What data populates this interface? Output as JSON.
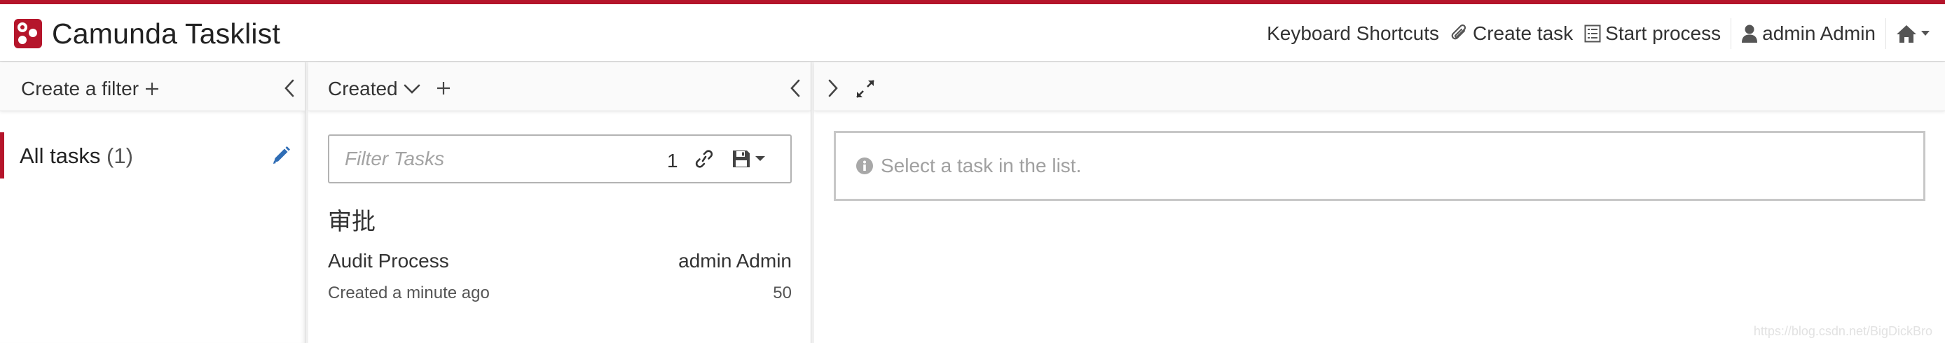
{
  "app": {
    "title": "Camunda Tasklist",
    "accent_color": "#b5152b"
  },
  "navbar": {
    "keyboard_shortcuts": "Keyboard Shortcuts",
    "create_task": {
      "label": "Create task",
      "icon": "paperclip-icon"
    },
    "start_process": {
      "label": "Start process",
      "icon": "list-alt-icon"
    },
    "user": {
      "label": "admin Admin",
      "icon": "user-icon"
    },
    "home": {
      "icon": "home-icon"
    }
  },
  "filters_panel": {
    "create_filter_label": "Create a filter",
    "items": [
      {
        "label": "All tasks",
        "count": "(1)",
        "active": true
      }
    ]
  },
  "task_list": {
    "sort_label": "Created",
    "search": {
      "placeholder": "Filter Tasks",
      "count": "1"
    },
    "tasks": [
      {
        "name": "审批",
        "process": "Audit Process",
        "assignee": "admin Admin",
        "created": "Created a minute ago",
        "priority": "50"
      }
    ]
  },
  "task_detail": {
    "empty_message": "Select a task in the list."
  },
  "watermark": "https://blog.csdn.net/BigDickBro"
}
